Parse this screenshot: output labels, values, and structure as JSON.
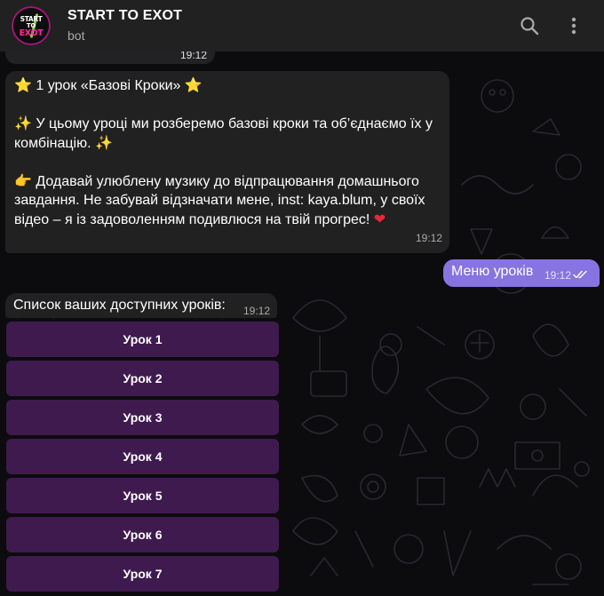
{
  "header": {
    "title": "START TO EXOT",
    "subtitle": "bot",
    "avatar_logo": [
      "START",
      "TO",
      "EXOT"
    ],
    "icons": {
      "search": "search-icon",
      "more": "more-vertical-icon"
    }
  },
  "previous_message": {
    "time": "19:12"
  },
  "lesson_message": {
    "title_prefix": "⭐",
    "title": " 1 урок «Базові Кроки» ",
    "title_suffix": "⭐",
    "para1_prefix": "✨",
    "para1": " У цьому уроці ми розберемо базові кроки та об’єднаємо їх у комбінацію. ",
    "para1_suffix": "✨",
    "para2_prefix": "👉",
    "para2": " Додавай улюблену музику до відпрацювання домашнього завдання. Не забувай відзначати мене, inst: kaya.blum, у своїх відео – я із задоволенням подивлюся на твій прогрес! ",
    "para2_suffix": "❤",
    "time": "19:12"
  },
  "outgoing_message": {
    "text": "Меню уроків",
    "time": "19:12",
    "status": "read-double-check"
  },
  "list_message": {
    "text": "Список ваших доступних уроків:",
    "time": "19:12"
  },
  "keyboard": {
    "buttons": [
      "Урок 1",
      "Урок 2",
      "Урок 3",
      "Урок 4",
      "Урок 5",
      "Урок 6",
      "Урок 7"
    ]
  },
  "colors": {
    "header_bg": "#212121",
    "incoming_bubble": "#212121",
    "outgoing_bubble": "#8774e1",
    "keyboard_button": "#4c1e60",
    "wallpaper": "#0c0b0e"
  }
}
